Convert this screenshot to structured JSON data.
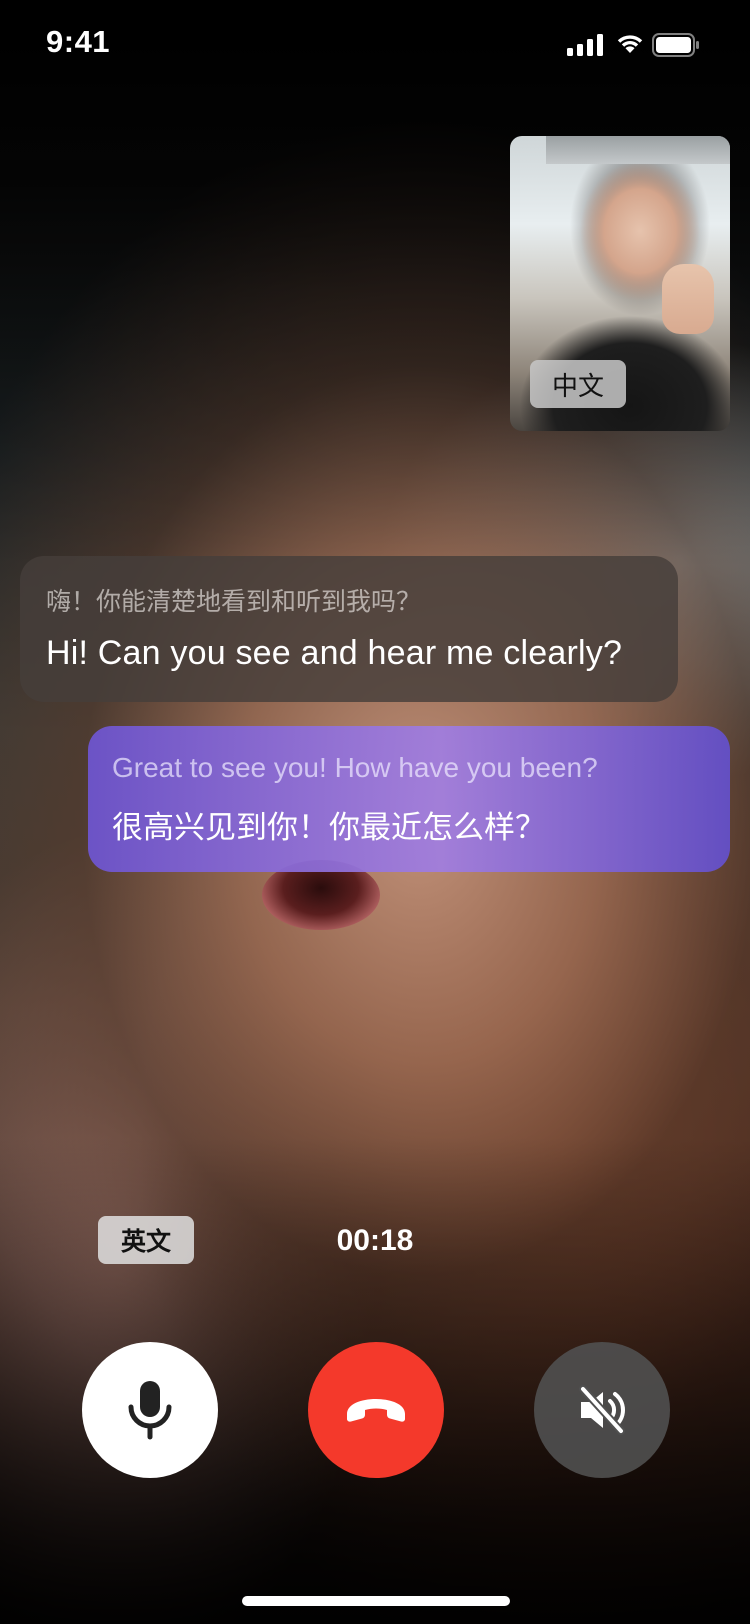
{
  "status_bar": {
    "time": "9:41",
    "signal_icon": "cellular-signal-icon",
    "wifi_icon": "wifi-icon",
    "battery_icon": "battery-full-icon"
  },
  "remote_video": {
    "language_label": "中文"
  },
  "local_video": {
    "language_label": "英文"
  },
  "subtitles": [
    {
      "speaker": "remote",
      "original": "嗨！你能清楚地看到和听到我吗？",
      "translation": "Hi! Can you see and hear me clearly?"
    },
    {
      "speaker": "local",
      "original": "Great to see you! How have you been?",
      "translation": "很高兴见到你！你最近怎么样？"
    }
  ],
  "call": {
    "duration": "00:18"
  },
  "controls": {
    "mic_icon": "microphone-icon",
    "end_call_icon": "hang-up-phone-icon",
    "speaker_icon": "speaker-muted-icon"
  },
  "colors": {
    "end_call": "#f4392b",
    "local_bubble_accent": "#8a6fe0",
    "remote_bubble": "#463e3a"
  }
}
